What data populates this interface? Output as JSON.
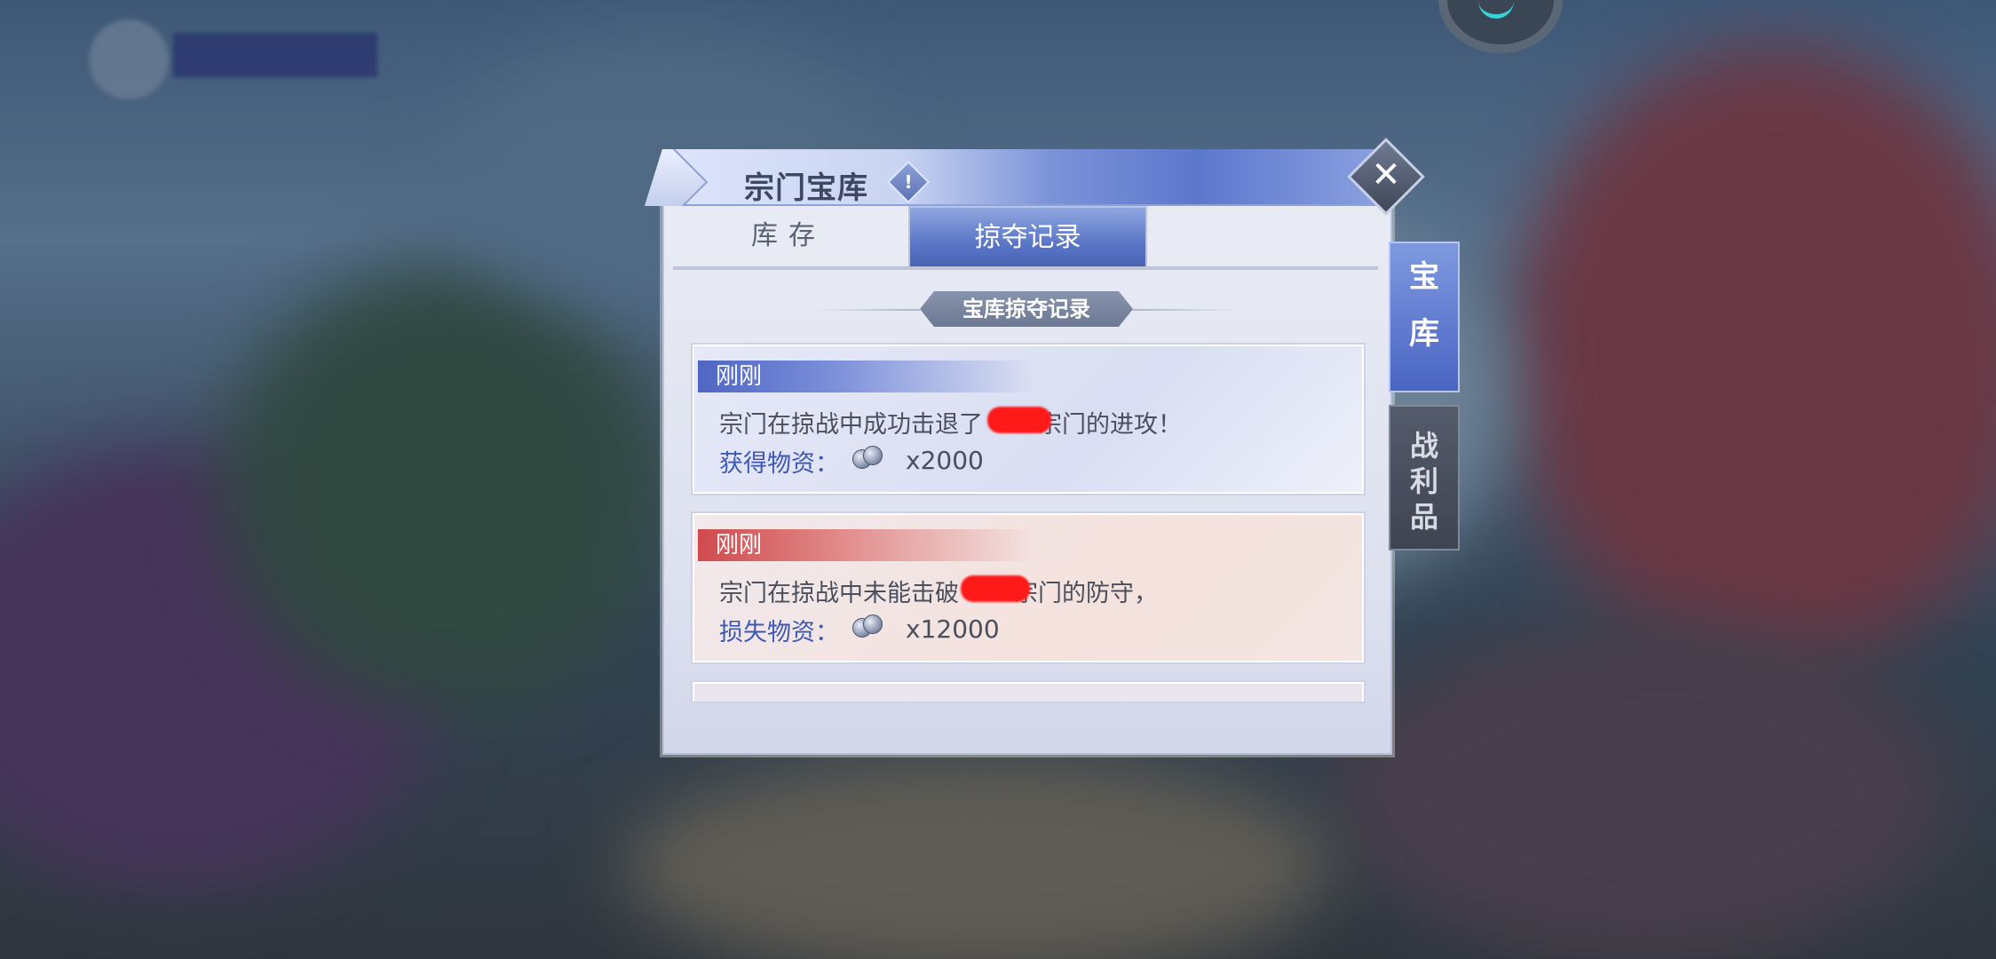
{
  "dialog": {
    "title": "宗门宝库",
    "info_icon": "!",
    "close_icon": "✕",
    "tabs": [
      {
        "label": "库存",
        "active": false
      },
      {
        "label": "掠夺记录",
        "active": true
      }
    ],
    "section_title": "宝库掠夺记录",
    "records": [
      {
        "time": "刚刚",
        "message_before": "宗门在掠战中成功击退了",
        "message_after": "宗门的进攻！",
        "resource_label": "获得物资：",
        "quantity": "x2000",
        "type": "gain"
      },
      {
        "time": "刚刚",
        "message_before": "宗门在掠战中未能击破",
        "message_after": "宗门的防守，",
        "resource_label": "损失物资：",
        "quantity": "x12000",
        "type": "loss"
      }
    ]
  },
  "side_tabs": {
    "vault": "宝库",
    "loot": "战利品"
  },
  "colors": {
    "gain_banner": "#4f66c4",
    "loss_banner": "#cf4a4e",
    "active_tab": "#5a76c6"
  }
}
